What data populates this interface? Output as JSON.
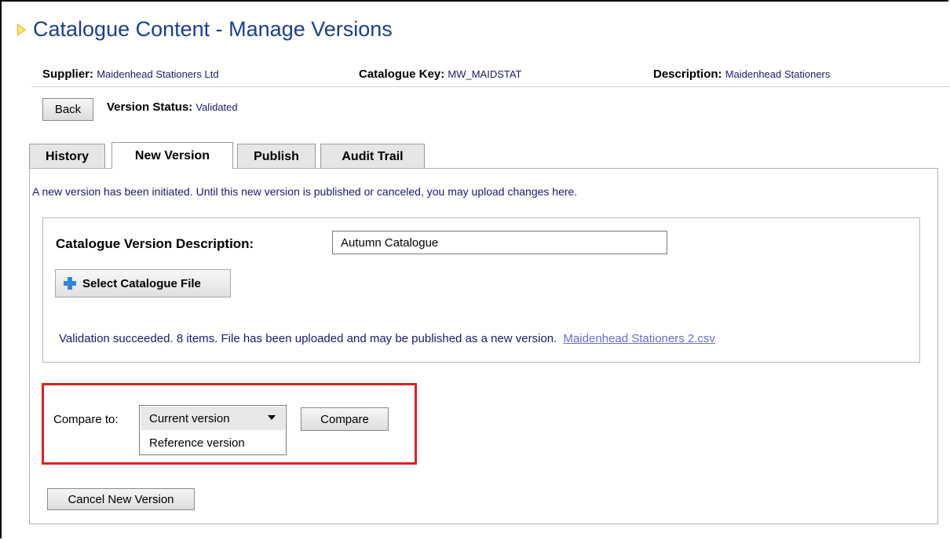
{
  "page": {
    "title": "Catalogue Content - Manage Versions"
  },
  "info": {
    "supplier_label": "Supplier:",
    "supplier_value": "Maidenhead Stationers Ltd",
    "key_label": "Catalogue Key:",
    "key_value": "MW_MAIDSTAT",
    "description_label": "Description:",
    "description_value": "Maidenhead Stationers"
  },
  "toolbar": {
    "back_label": "Back",
    "status_label": "Version Status:",
    "status_value": "Validated"
  },
  "tabs": [
    {
      "label": "History",
      "active": false
    },
    {
      "label": "New Version",
      "active": true
    },
    {
      "label": "Publish",
      "active": false
    },
    {
      "label": "Audit Trail",
      "active": false
    }
  ],
  "new_version": {
    "intro_text": "A new version has been initiated. Until this new version is published or canceled, you may upload changes here.",
    "desc_label": "Catalogue Version Description:",
    "desc_value": "Autumn Catalogue",
    "select_file_label": "Select Catalogue File",
    "validation_text": "Validation succeeded. 8 items. File has been uploaded and may be published as a new version.",
    "file_link": "Maidenhead Stationers 2.csv"
  },
  "compare": {
    "label": "Compare to:",
    "selected": "Current version",
    "options": [
      "Current version",
      "Reference version"
    ],
    "button_label": "Compare"
  },
  "cancel_label": "Cancel New Version",
  "colors": {
    "title": "#1a3f8f",
    "text_blue": "#1a1a6e",
    "link": "#6a6ad8",
    "highlight": "#e02020",
    "accent": "#f0b400"
  }
}
